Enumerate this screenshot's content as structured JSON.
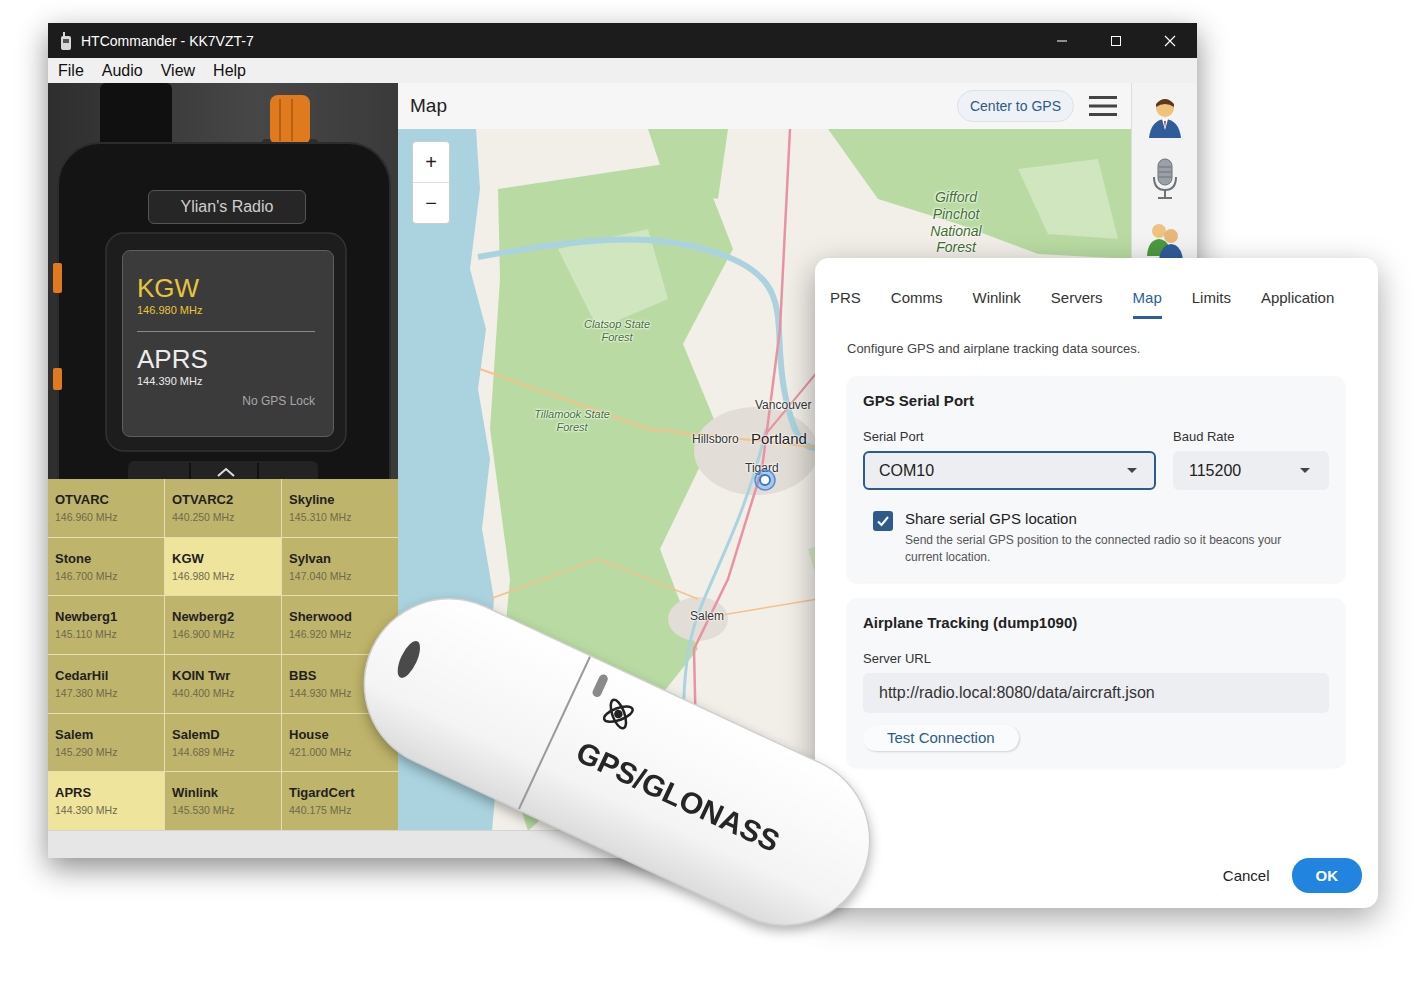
{
  "window": {
    "title": "HTCommander - KK7VZT-7"
  },
  "menu": [
    "File",
    "Audio",
    "View",
    "Help"
  ],
  "radio": {
    "name": "Ylian's Radio",
    "vfo_a": {
      "name": "KGW",
      "freq": "146.980 MHz"
    },
    "vfo_b": {
      "name": "APRS",
      "freq": "144.390 MHz"
    },
    "gps_status": "No GPS Lock"
  },
  "channels": [
    {
      "name": "OTVARC",
      "freq": "146.960 MHz",
      "selected": false
    },
    {
      "name": "OTVARC2",
      "freq": "440.250 MHz",
      "selected": false
    },
    {
      "name": "Skyline",
      "freq": "145.310 MHz",
      "selected": false
    },
    {
      "name": "Stone",
      "freq": "146.700 MHz",
      "selected": false
    },
    {
      "name": "KGW",
      "freq": "146.980 MHz",
      "selected": true
    },
    {
      "name": "Sylvan",
      "freq": "147.040 MHz",
      "selected": false
    },
    {
      "name": "Newberg1",
      "freq": "145.110 MHz",
      "selected": false
    },
    {
      "name": "Newberg2",
      "freq": "146.900 MHz",
      "selected": false
    },
    {
      "name": "Sherwood",
      "freq": "146.920 MHz",
      "selected": false
    },
    {
      "name": "CedarHil",
      "freq": "147.380 MHz",
      "selected": false
    },
    {
      "name": "KOIN Twr",
      "freq": "440.400 MHz",
      "selected": false
    },
    {
      "name": "BBS",
      "freq": "144.930 MHz",
      "selected": false
    },
    {
      "name": "Salem",
      "freq": "145.290 MHz",
      "selected": false
    },
    {
      "name": "SalemD",
      "freq": "144.689 MHz",
      "selected": false
    },
    {
      "name": "House",
      "freq": "421.000 MHz",
      "selected": false
    },
    {
      "name": "APRS",
      "freq": "144.390 MHz",
      "selected": true
    },
    {
      "name": "Winlink",
      "freq": "145.530 MHz",
      "selected": false
    },
    {
      "name": "TigardCert",
      "freq": "440.175 MHz",
      "selected": false
    }
  ],
  "map": {
    "title": "Map",
    "center_button": "Center to GPS",
    "zoom_in": "+",
    "zoom_out": "−",
    "labels": [
      {
        "text": "Gifford Pinchot National Forest",
        "kind": "forest"
      },
      {
        "text": "Clatsop State Forest",
        "kind": "forest"
      },
      {
        "text": "Tillamook State Forest",
        "kind": "forest"
      },
      {
        "text": "Vancouver",
        "kind": "city"
      },
      {
        "text": "Hillsboro",
        "kind": "city"
      },
      {
        "text": "Portland",
        "kind": "major"
      },
      {
        "text": "Tigard",
        "kind": "city"
      },
      {
        "text": "Salem",
        "kind": "city"
      }
    ]
  },
  "settings": {
    "tabs": [
      {
        "label": "PRS",
        "selected": false
      },
      {
        "label": "Comms",
        "selected": false
      },
      {
        "label": "Winlink",
        "selected": false
      },
      {
        "label": "Servers",
        "selected": false
      },
      {
        "label": "Map",
        "selected": true
      },
      {
        "label": "Limits",
        "selected": false
      },
      {
        "label": "Application",
        "selected": false
      }
    ],
    "description": "Configure GPS and airplane tracking data sources.",
    "gps": {
      "title": "GPS Serial Port",
      "port_label": "Serial Port",
      "port": "COM10",
      "baud_label": "Baud Rate",
      "baud": "115200",
      "share": {
        "label": "Share serial GPS location",
        "description": "Send the serial GPS position to the connected radio so it beacons your current location.",
        "checked": true
      }
    },
    "airplane": {
      "title": "Airplane Tracking (dump1090)",
      "url_label": "Server URL",
      "url": "http://radio.local:8080/data/aircraft.json",
      "test_button": "Test Connection"
    },
    "buttons": [
      {
        "label": "Cancel",
        "primary": false
      },
      {
        "label": "OK",
        "primary": true
      }
    ]
  },
  "dongle": {
    "label": "GPS/GLONASS"
  }
}
